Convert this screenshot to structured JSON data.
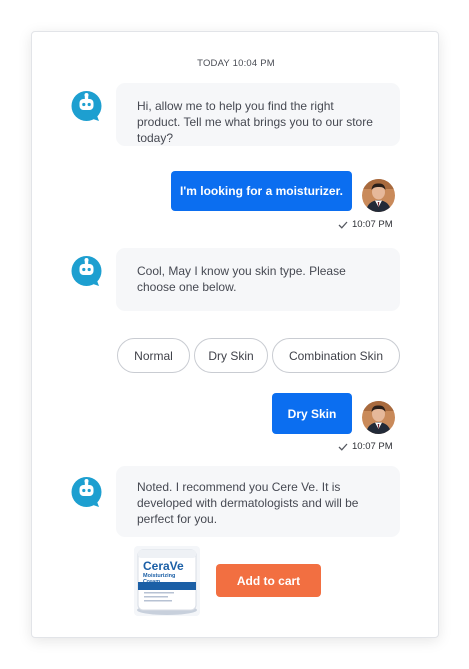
{
  "chat": {
    "date_header": "TODAY 10:04 PM",
    "messages": [
      {
        "sender": "bot",
        "text": "Hi, allow me to help you find the right product. Tell me what brings you to our store today?"
      },
      {
        "sender": "user",
        "text": "I'm looking for a moisturizer.",
        "time": "10:07 PM"
      },
      {
        "sender": "bot",
        "text": "Cool, May I know you skin type.  Please choose one below."
      },
      {
        "sender": "user",
        "text": "Dry Skin",
        "time": "10:07 PM"
      },
      {
        "sender": "bot",
        "text": "Noted. I recommend you Cere Ve. It is developed with dermatologists and will be perfect for you."
      }
    ],
    "quick_replies": [
      "Normal",
      "Dry Skin",
      "Combination Skin"
    ],
    "product": {
      "brand": "CeraVe",
      "line1": "Moisturizing",
      "line2": "Cream",
      "cta": "Add to cart"
    }
  },
  "colors": {
    "user_bubble": "#0b6ef0",
    "bot_bubble": "#f6f7f9",
    "bot_avatar": "#1d9fd0",
    "cta": "#f26f41"
  },
  "icons": {
    "bot_avatar": "robot-chat-icon",
    "read_receipt": "check-icon"
  }
}
